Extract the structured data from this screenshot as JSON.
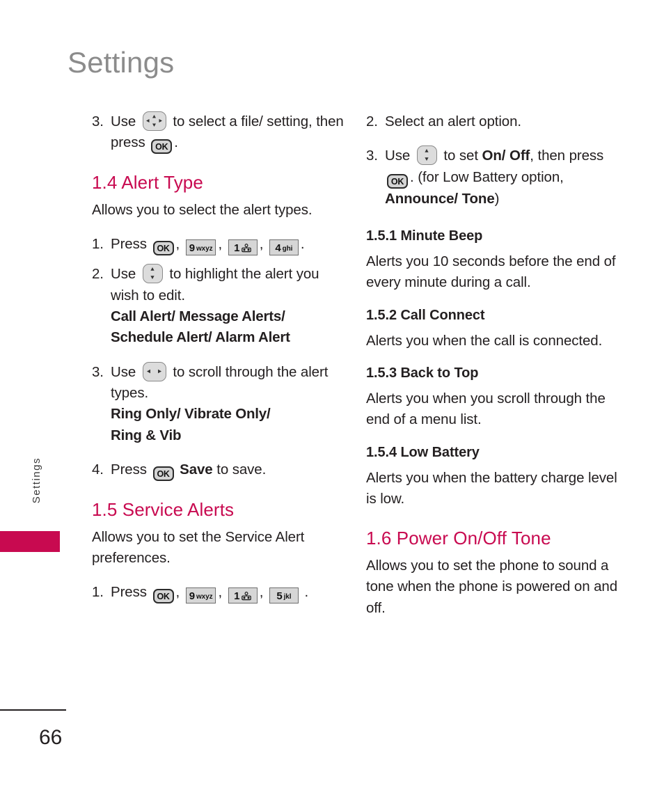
{
  "page": {
    "header_title": "Settings",
    "side_tab_label": "Settings",
    "page_number": "66",
    "accent_color": "#c80a50",
    "header_color": "#8c8c8c",
    "text_color": "#231f20"
  },
  "keys": {
    "ok": "OK",
    "k9_num": "9",
    "k9_letters": "wxyz",
    "k1_num": "1",
    "k1_icon": "voicemail-icon",
    "k4_num": "4",
    "k4_letters": "ghi",
    "k5_num": "5",
    "k5_letters": "jkl",
    "nav_4way": "four-way-navigation-key-icon",
    "nav_updown": "up-down-navigation-key-icon",
    "nav_leftright": "left-right-navigation-key-icon"
  },
  "left_column": {
    "step3_top": {
      "num": "3.",
      "part1": "Use",
      "part2": "to select a file/ setting, then press",
      "part3": "."
    },
    "alert_type": {
      "heading": "1.4 Alert Type",
      "intro": "Allows you to select the alert types.",
      "step1": {
        "num": "1.",
        "label": "Press",
        "trailing": "."
      },
      "step2": {
        "num": "2.",
        "part1": "Use",
        "part2": "to highlight the alert you wish to edit.",
        "options_line1": "Call Alert/ Message Alerts/",
        "options_line2": "Schedule Alert/ Alarm Alert"
      },
      "step3": {
        "num": "3.",
        "part1": "Use",
        "part2": "to scroll through the alert types.",
        "options_line1": "Ring Only/ Vibrate Only/",
        "options_line2": "Ring & Vib"
      },
      "step4": {
        "num": "4.",
        "part1": "Press",
        "part2": "Save",
        "part3": "to save."
      }
    },
    "service_alerts": {
      "heading": "1.5 Service Alerts",
      "intro": "Allows you to set the Service Alert preferences.",
      "step1": {
        "num": "1.",
        "label": "Press",
        "trailing": "."
      }
    }
  },
  "right_column": {
    "step2": {
      "num": "2.",
      "text": "Select an alert option."
    },
    "step3": {
      "num": "3.",
      "part1": "Use",
      "part2": "to set",
      "bold1": "On/ Off",
      "part3": ", then press",
      "part4": ". (for Low Battery option,",
      "bold2": "Announce/ Tone",
      "part5": ")"
    },
    "subsections": [
      {
        "heading": "1.5.1 Minute Beep",
        "body": "Alerts you 10 seconds before the end of every minute during a call."
      },
      {
        "heading": "1.5.2 Call Connect",
        "body": "Alerts you when the call is connected."
      },
      {
        "heading": "1.5.3 Back to Top",
        "body": "Alerts you when you scroll through the end of a menu list."
      },
      {
        "heading": "1.5.4 Low Battery",
        "body": "Alerts you when the battery charge level is low."
      }
    ],
    "power_tone": {
      "heading": "1.6 Power On/Off Tone",
      "body": "Allows you to set the phone to sound a tone when the phone is powered on and off."
    }
  }
}
